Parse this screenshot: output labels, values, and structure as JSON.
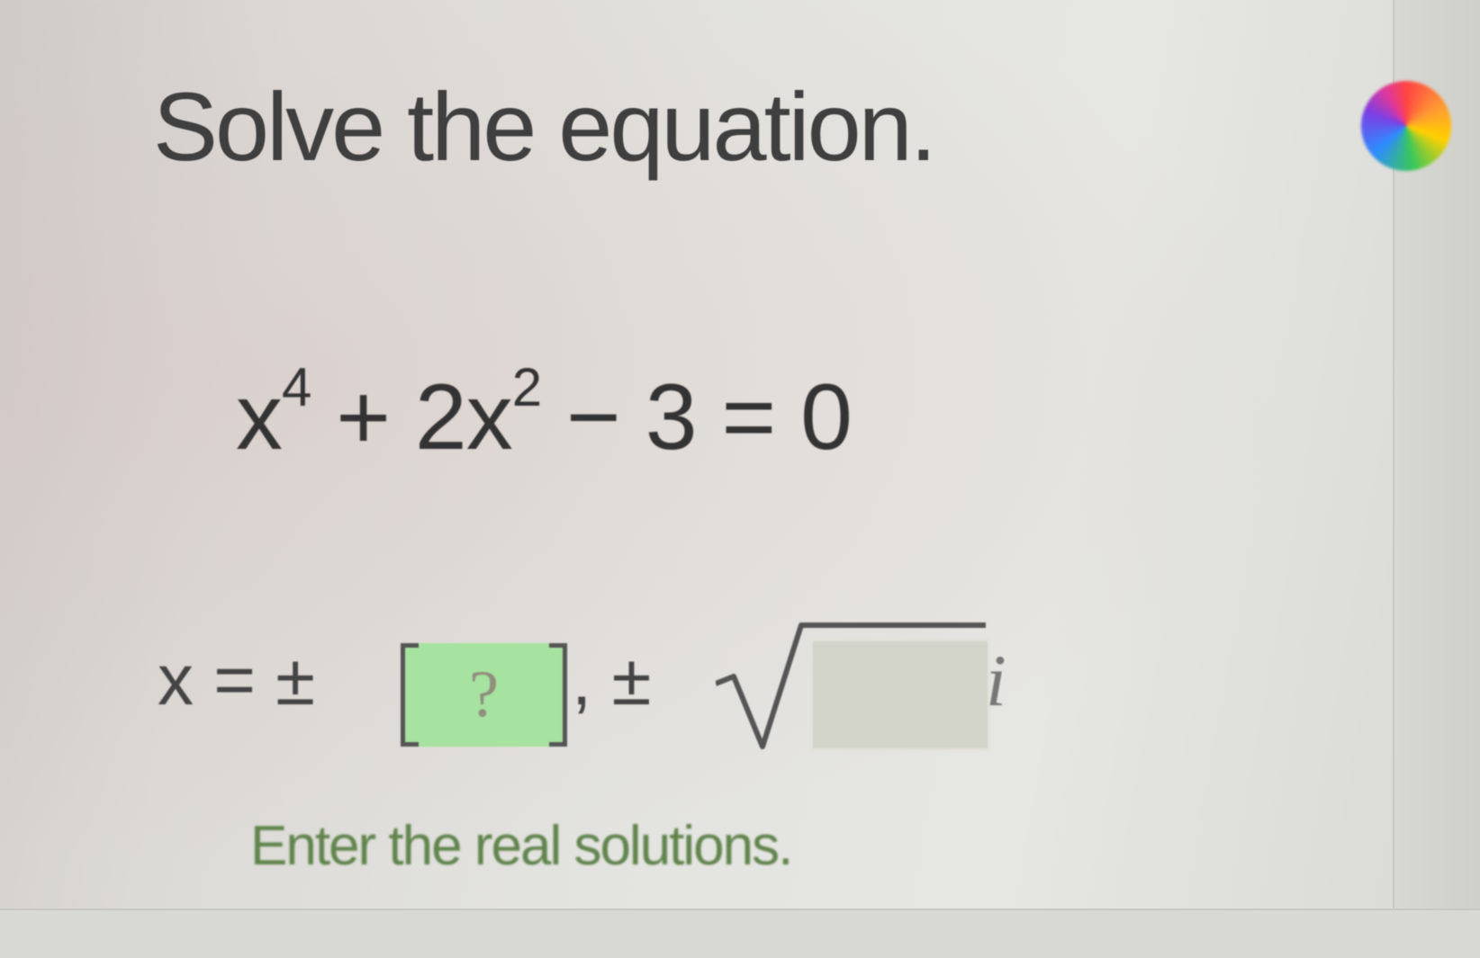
{
  "question": {
    "title": "Solve the equation."
  },
  "equation": {
    "term1_base": "x",
    "term1_exp": "4",
    "op1": "+",
    "term2_coef_base": "2x",
    "term2_exp": "2",
    "op2": "−",
    "term3": "3",
    "equals": "=",
    "rhs": "0"
  },
  "answer": {
    "prefix": "x = ±",
    "box1_placeholder": "?",
    "separator": ", ±",
    "imaginary_unit": "i"
  },
  "instruction": "Enter the real solutions.",
  "colors": {
    "answer_box_active": "#a6e2a0",
    "instruction_text": "#61844d",
    "title_text": "#3f3f3f"
  },
  "icons": {
    "help_wheel": "color-wheel-icon"
  }
}
